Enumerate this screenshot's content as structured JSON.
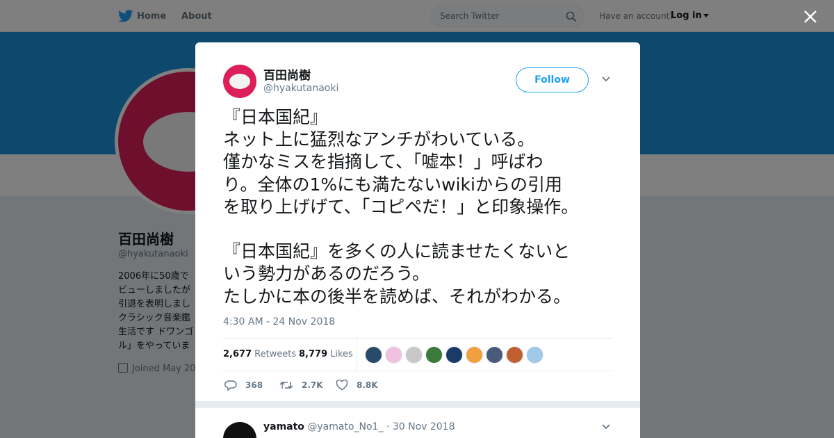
{
  "nav": {
    "home": "Home",
    "about": "About",
    "search_placeholder": "Search Twitter",
    "have_account": "Have an account?",
    "login": "Log in"
  },
  "profile": {
    "name": "百田尚樹",
    "handle": "@hyakutanaoki",
    "bio_lines": [
      "2006年に50歳で",
      "ビューしましたが",
      "引退を表明しまし",
      "クラシック音楽鑑",
      "生活です ドワンゴ",
      "ル」をやっていま"
    ],
    "joined": "Joined May 20"
  },
  "tweet": {
    "name": "百田尚樹",
    "handle": "@hyakutanaoki",
    "follow": "Follow",
    "lines": [
      "『日本国紀』",
      "ネット上に猛烈なアンチがわいている。",
      "僅かなミスを指摘して、「嘘本！」呼ばわ",
      "り。全体の1%にも満たないwikiからの引用",
      "を取り上げげて、「コピペだ！」と印象操作。",
      "",
      "『日本国紀』を多くの人に読ませたくないと",
      "いう勢力があるのだろう。",
      "たしかに本の後半を読めば、それがわかる。"
    ],
    "timestamp": "4:30 AM - 24 Nov 2018",
    "retweets_count": "2,677",
    "retweets_label": "Retweets",
    "likes_count": "8,779",
    "likes_label": "Likes",
    "actions": {
      "replies": "368",
      "retweets": "2.7K",
      "likes": "8.8K"
    },
    "liker_colors": [
      "#2a4a6a",
      "#f0c0e0",
      "#c8c8c8",
      "#3a7a3a",
      "#1a3a6a",
      "#f0a040",
      "#4a5a7a",
      "#c06030",
      "#a0c8e8"
    ]
  },
  "reply": {
    "name": "yamato",
    "handle": "@yamato_No1_",
    "sep": "·",
    "date": "30 Nov 2018"
  }
}
